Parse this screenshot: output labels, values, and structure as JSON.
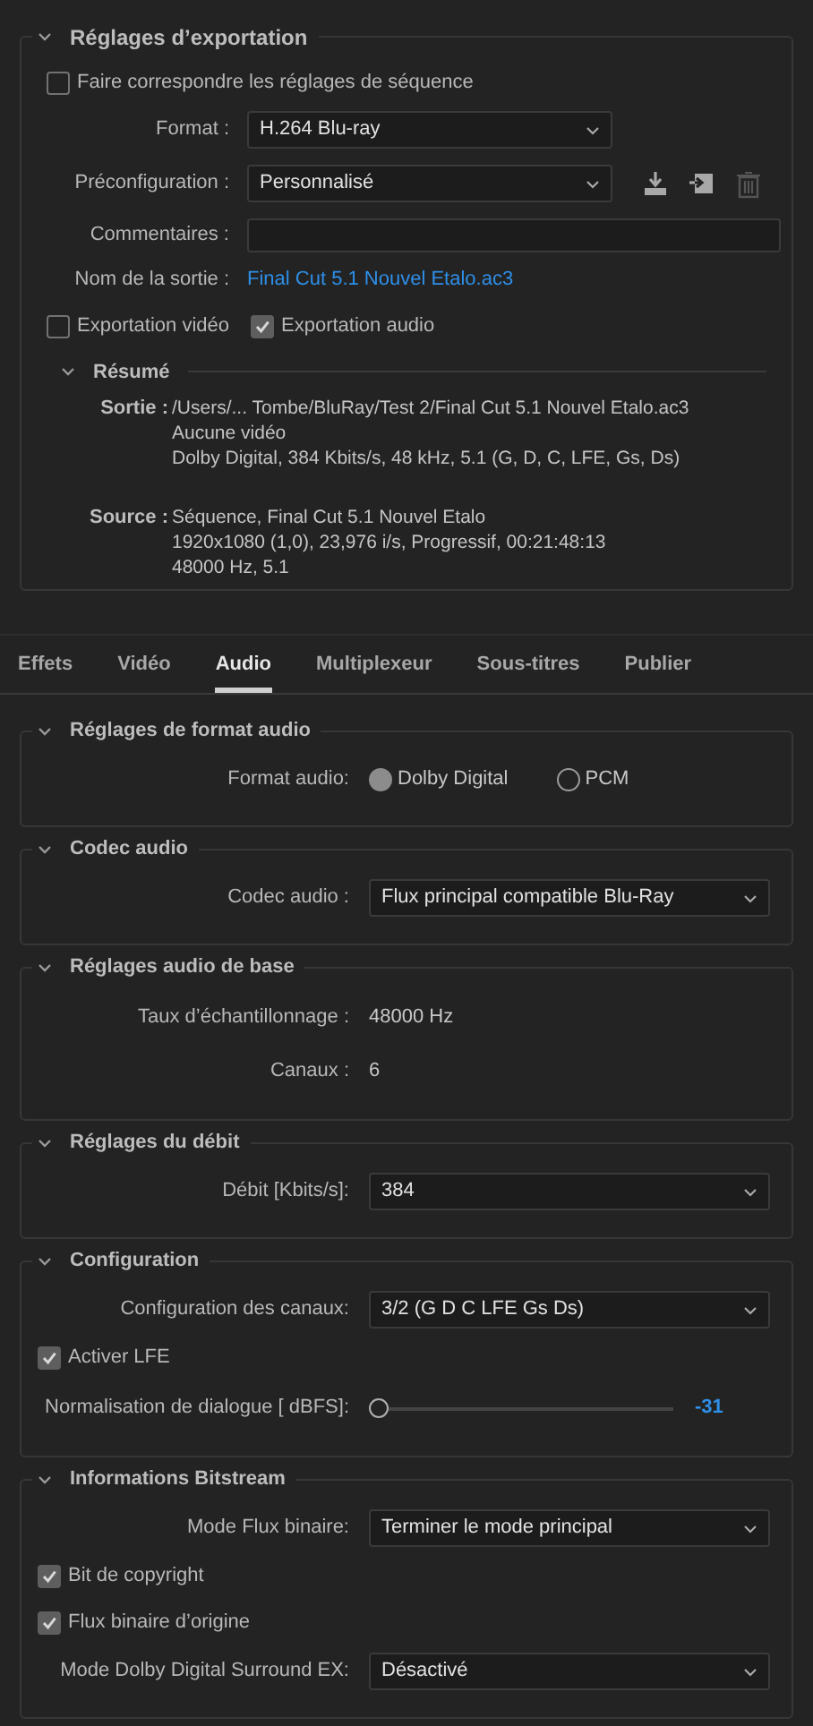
{
  "export_settings": {
    "title": "Réglages d’exportation",
    "expanded": true,
    "match_sequence": {
      "label": "Faire correspondre les réglages de séquence",
      "checked": false
    },
    "format": {
      "label": "Format :",
      "value": "H.264 Blu-ray"
    },
    "preset": {
      "label": "Préconfiguration :",
      "value": "Personnalisé",
      "actions": [
        {
          "kind": "save",
          "disabled": false
        },
        {
          "kind": "import",
          "disabled": false
        },
        {
          "kind": "delete",
          "disabled": true
        }
      ]
    },
    "comments": {
      "label": "Commentaires :"
    },
    "output_name": {
      "label": "Nom de la sortie :",
      "value": "Final Cut 5.1 Nouvel Etalo.ac3"
    },
    "export_options": [
      {
        "label": "Exportation vidéo",
        "checked": false
      },
      {
        "label": "Exportation audio",
        "checked": true
      }
    ],
    "summary": {
      "title": "Résumé",
      "expanded": true,
      "entries": [
        {
          "label": "Sortie :",
          "lines": [
            "/Users/... Tombe/BluRay/Test 2/Final Cut 5.1 Nouvel Etalo.ac3",
            "Aucune vidéo",
            "Dolby Digital, 384  Kbits/s, 48  kHz, 5.1 (G, D, C, LFE, Gs, Ds)"
          ]
        },
        {
          "label": "Source :",
          "lines": [
            "Séquence, Final Cut 5.1 Nouvel Etalo",
            "1920x1080 (1,0), 23,976  i/s, Progressif, 00:21:48:13",
            "48000 Hz, 5.1"
          ]
        }
      ]
    }
  },
  "tabs": [
    {
      "label": "Effets",
      "selected": false
    },
    {
      "label": "Vidéo",
      "selected": false
    },
    {
      "label": "Audio",
      "selected": true
    },
    {
      "label": "Multiplexeur",
      "selected": false
    },
    {
      "label": "Sous-titres",
      "selected": false
    },
    {
      "label": "Publier",
      "selected": false
    }
  ],
  "sections": [
    {
      "title": "Réglages de format audio",
      "expanded": true,
      "rows": [
        {
          "kind": "radio",
          "label": "Format audio:",
          "options": [
            {
              "label": "Dolby Digital",
              "selected": true
            },
            {
              "label": "PCM",
              "selected": false
            }
          ]
        }
      ]
    },
    {
      "title": "Codec audio",
      "expanded": true,
      "rows": [
        {
          "kind": "select",
          "label": "Codec audio :",
          "value": "Flux principal compatible Blu-Ray"
        }
      ]
    },
    {
      "title": "Réglages audio de base",
      "expanded": true,
      "rows": [
        {
          "kind": "value",
          "label": "Taux d’échantillonnage :",
          "value": "48000 Hz"
        },
        {
          "kind": "value",
          "label": "Canaux :",
          "value": "6"
        }
      ]
    },
    {
      "title": "Réglages du débit",
      "expanded": true,
      "rows": [
        {
          "kind": "select",
          "label": "Débit [Kbits/s]:",
          "value": "384"
        }
      ]
    },
    {
      "title": "Configuration",
      "expanded": true,
      "rows": [
        {
          "kind": "select",
          "label": "Configuration des canaux:",
          "value": "3/2 (G D C LFE Gs Ds)"
        },
        {
          "kind": "checkbox",
          "label": "Activer LFE",
          "checked": true
        },
        {
          "kind": "slider",
          "label": "Normalisation de dialogue [ dBFS]:",
          "level": 0,
          "reading": "-31"
        }
      ]
    },
    {
      "title": "Informations Bitstream",
      "expanded": true,
      "rows": [
        {
          "kind": "select",
          "label": "Mode Flux binaire:",
          "value": "Terminer le mode principal"
        },
        {
          "kind": "checkbox",
          "label": "Bit de copyright",
          "checked": true
        },
        {
          "kind": "checkbox",
          "label": "Flux binaire d’origine",
          "checked": true
        },
        {
          "kind": "select",
          "label": "Mode Dolby Digital Surround EX:",
          "value": "Désactivé"
        }
      ]
    }
  ]
}
